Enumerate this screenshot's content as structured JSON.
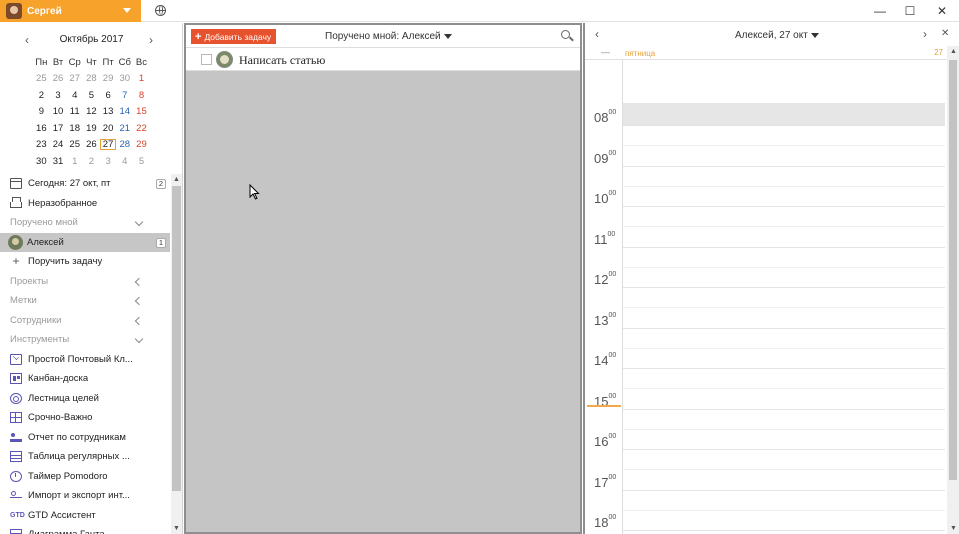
{
  "titlebar": {
    "user_name": "Сергей",
    "controls": [
      "—",
      "☐",
      "✕"
    ]
  },
  "calendar": {
    "month_title": "Октябрь 2017",
    "prev": "‹",
    "next": "›",
    "weekdays": [
      "Пн",
      "Вт",
      "Ср",
      "Чт",
      "Пт",
      "Сб",
      "Вс"
    ],
    "weeks": [
      [
        "25",
        "26",
        "27",
        "28",
        "29",
        "30",
        "1"
      ],
      [
        "2",
        "3",
        "4",
        "5",
        "6",
        "7",
        "8"
      ],
      [
        "9",
        "10",
        "11",
        "12",
        "13",
        "14",
        "15"
      ],
      [
        "16",
        "17",
        "18",
        "19",
        "20",
        "21",
        "22"
      ],
      [
        "23",
        "24",
        "25",
        "26",
        "27",
        "28",
        "29"
      ],
      [
        "30",
        "31",
        "1",
        "2",
        "3",
        "4",
        "5"
      ]
    ],
    "today": "27"
  },
  "sidebar": {
    "items": [
      {
        "label": "Сегодня: 27 окт, пт",
        "icon": "calendar-icon",
        "badge": "2"
      },
      {
        "label": "Неразобранное",
        "icon": "inbox-icon"
      },
      {
        "label": "Поручено мной",
        "section": true,
        "chevron": "down"
      },
      {
        "label": "Алексей",
        "icon": "avatar",
        "badge": "1",
        "active": true
      },
      {
        "label": "Поручить задачу",
        "icon": "plus-icon"
      },
      {
        "label": "Проекты",
        "section": true,
        "chevron": "left"
      },
      {
        "label": "Метки",
        "section": true,
        "chevron": "left"
      },
      {
        "label": "Сотрудники",
        "section": true,
        "chevron": "left"
      },
      {
        "label": "Инструменты",
        "section": true,
        "chevron": "down"
      },
      {
        "label": "Простой Почтовый Кл...",
        "icon": "mail-icon"
      },
      {
        "label": "Канбан-доска",
        "icon": "kanban-icon"
      },
      {
        "label": "Лестница целей",
        "icon": "target-icon"
      },
      {
        "label": "Срочно-Важно",
        "icon": "grid-icon"
      },
      {
        "label": "Отчет по сотрудникам",
        "icon": "people-icon"
      },
      {
        "label": "Таблица регулярных ...",
        "icon": "table-icon"
      },
      {
        "label": "Таймер Pomodoro",
        "icon": "timer-icon"
      },
      {
        "label": "Импорт и экспорт инт...",
        "icon": "share-icon"
      },
      {
        "label": "GTD Ассистент",
        "icon": "gtd-icon"
      },
      {
        "label": "Диаграмма Ганта",
        "icon": "gantt-icon"
      }
    ]
  },
  "tasks": {
    "add_label": "Добавить задачу",
    "filter_label": "Поручено мной: Алексей",
    "items": [
      {
        "title": "Написать статью"
      }
    ]
  },
  "day_view": {
    "title": "Алексей, 27 окт",
    "day_name": "пятница",
    "day_number": "27",
    "allday_dash": "—",
    "hours": [
      "08",
      "09",
      "10",
      "11",
      "12",
      "13",
      "14",
      "15",
      "16",
      "17",
      "18"
    ],
    "minutes": "00"
  },
  "colors": {
    "accent": "#f6a22b",
    "add_button": "#e8532f",
    "weekend": "#d9432c",
    "saturday": "#2a63b8",
    "now_line": "#f2a94a"
  }
}
